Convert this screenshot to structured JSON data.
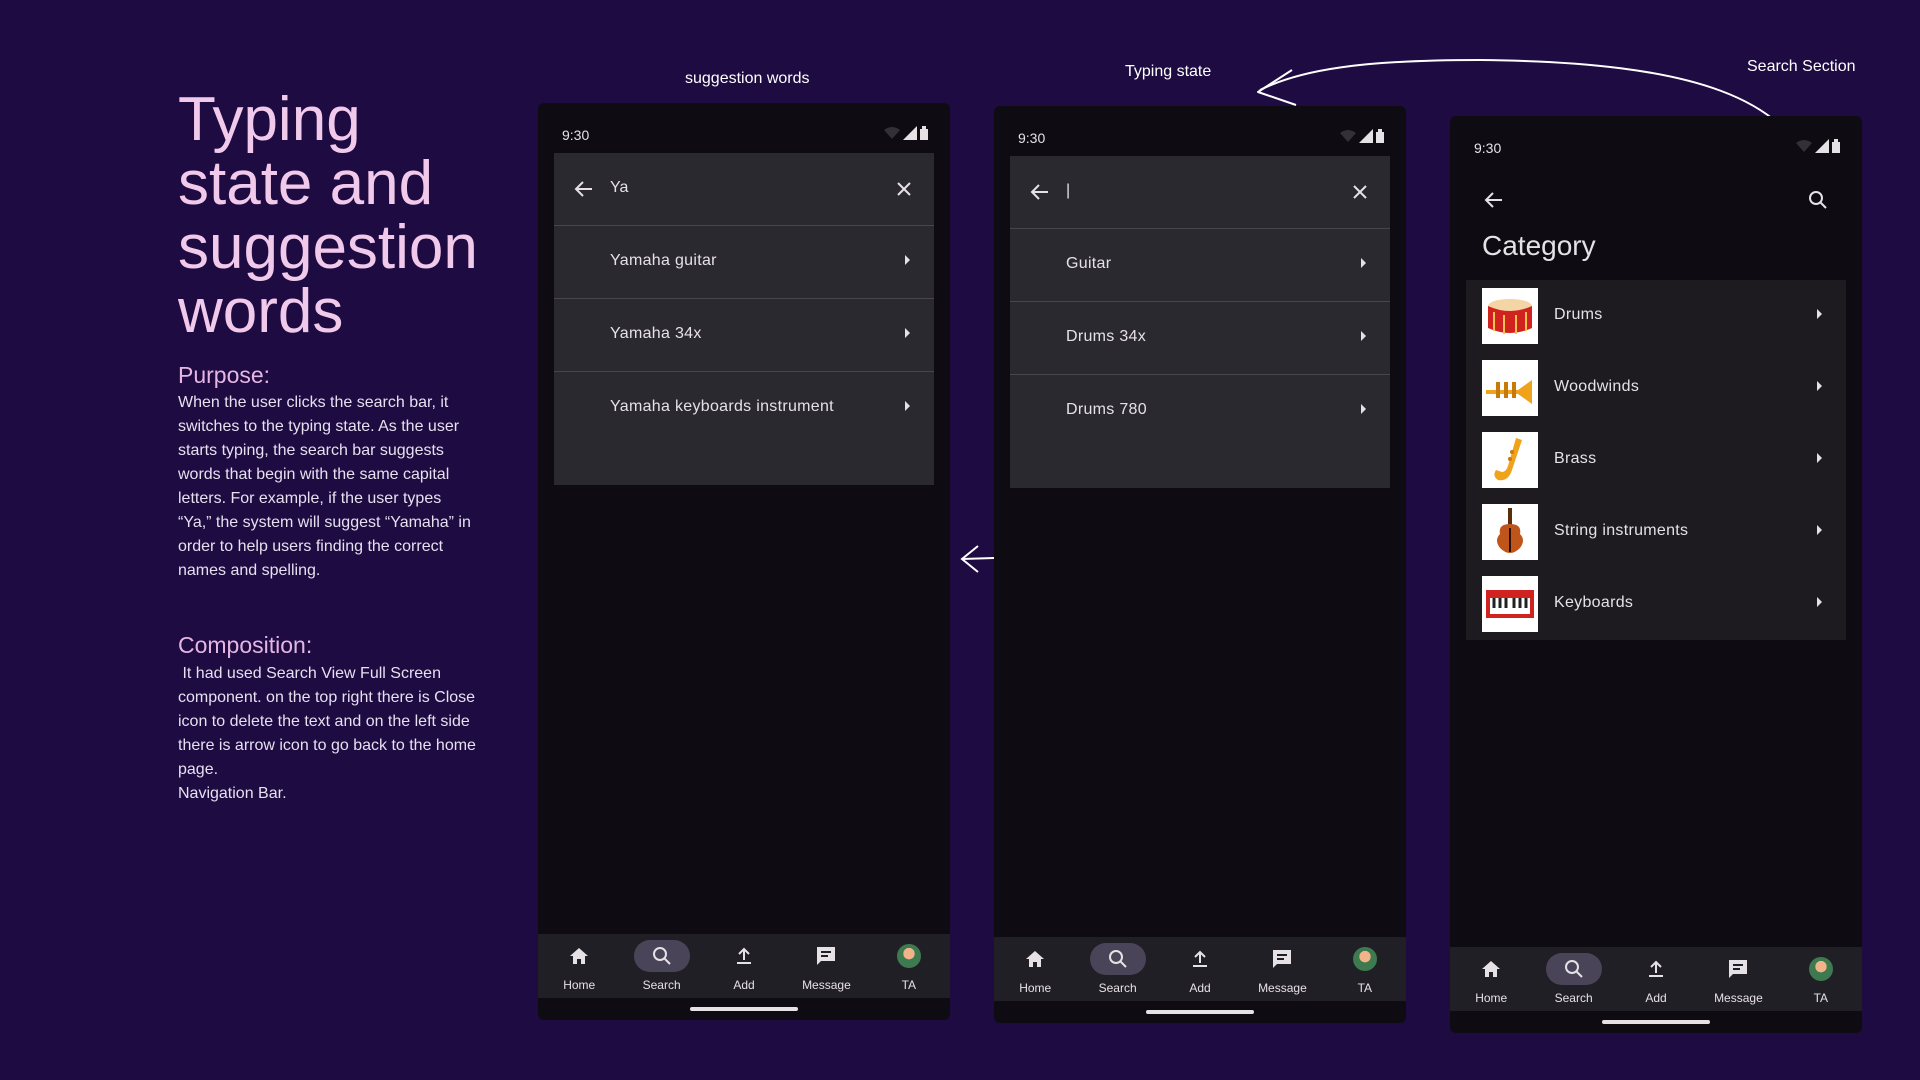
{
  "intro": {
    "heading": "Typing state and suggestion words",
    "purpose_title": "Purpose:",
    "purpose_text": "When the user clicks the search bar, it switches to the typing state. As the user starts typing, the search bar suggests words that begin with the same capital letters. For example, if the user types “Ya,” the system will suggest “Yamaha” in order to help users finding the correct names and spelling.",
    "composition_title": "Composition:",
    "composition_text": " It had used Search View Full Screen component. on the top right there is Close icon to delete the text and on the left side there is arrow icon to go back to the home page.\nNavigation Bar."
  },
  "labels": {
    "suggestion": "suggestion words",
    "typing": "Typing state",
    "search_section": "Search Section"
  },
  "status": {
    "time": "9:30"
  },
  "nav": {
    "home": "Home",
    "search": "Search",
    "add": "Add",
    "message": "Message",
    "profile": "TA"
  },
  "phone1": {
    "query": "Ya",
    "suggestions": [
      "Yamaha guitar",
      "Yamaha 34x",
      "Yamaha keyboards instrument"
    ]
  },
  "phone2": {
    "query": "|",
    "suggestions": [
      "Guitar",
      "Drums 34x",
      "Drums 780"
    ]
  },
  "phone3": {
    "title": "Category",
    "categories": [
      "Drums",
      "Woodwinds",
      "Brass",
      "String instruments",
      "Keyboards"
    ]
  },
  "colors": {
    "background": "#1d0b42",
    "heading": "#f1c9ea",
    "panel": "#2b2930",
    "nav_active": "#4a4458"
  }
}
